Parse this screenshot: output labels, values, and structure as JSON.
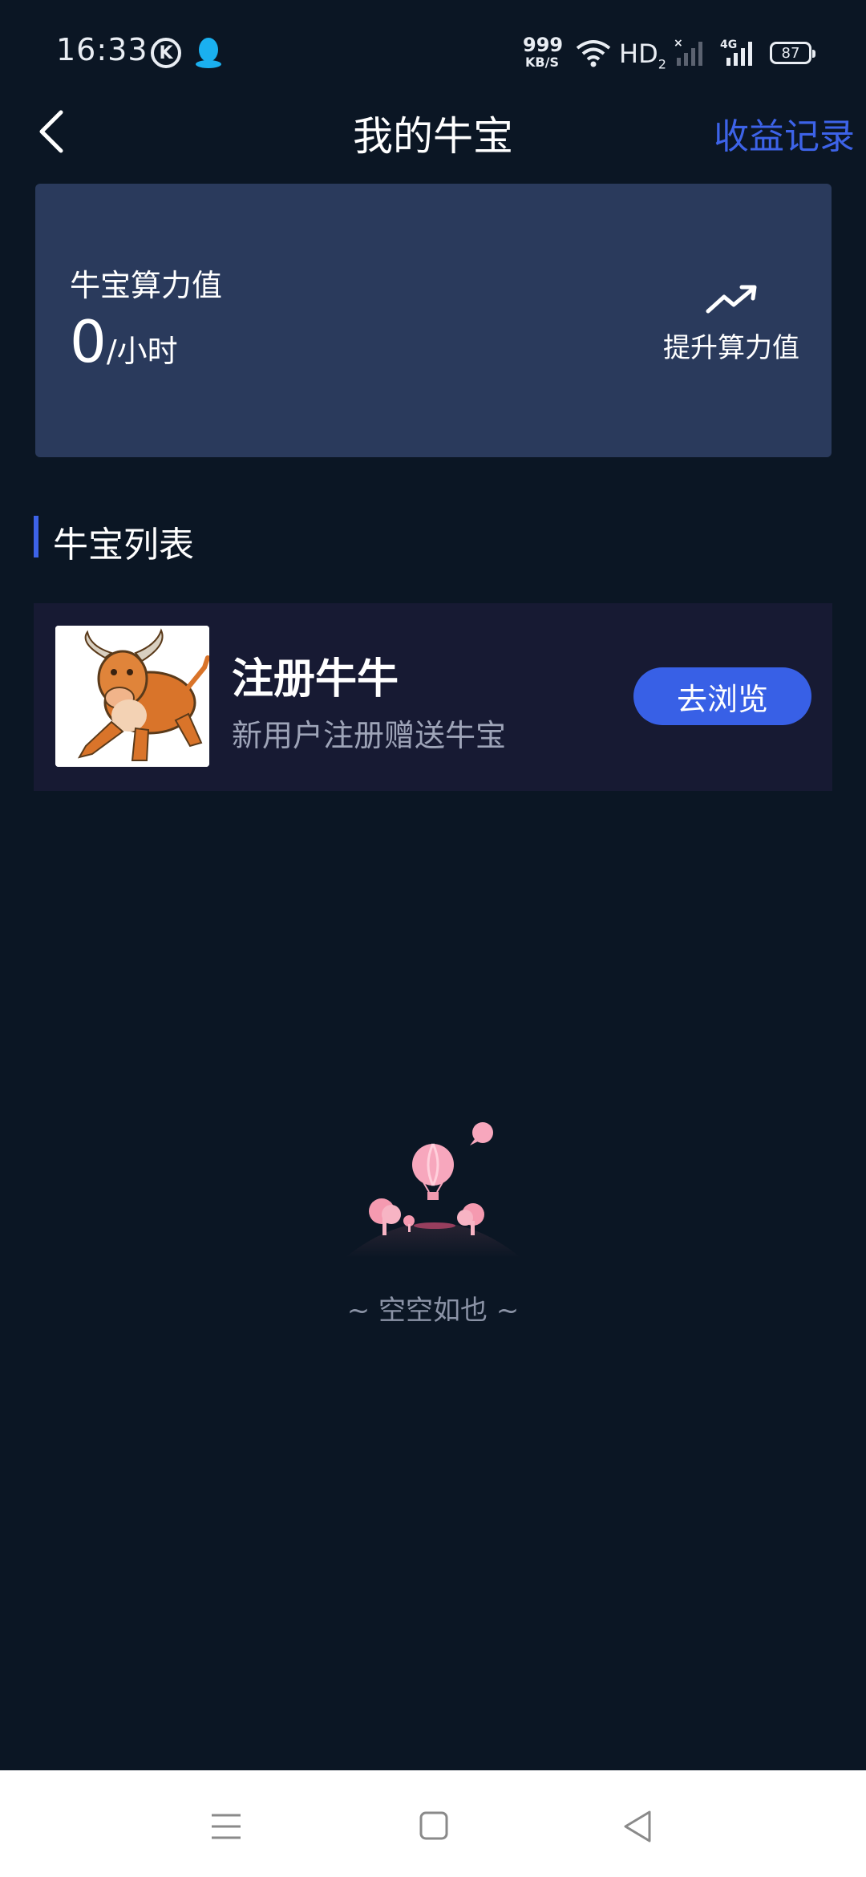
{
  "status_bar": {
    "time": "16:33",
    "net_speed_value": "999",
    "net_speed_unit": "KB/S",
    "hd_label": "HD",
    "hd_sub": "2",
    "network_type": "4G",
    "battery": "87",
    "icons": [
      "k-icon",
      "qq-icon",
      "wifi-icon",
      "signal-icon",
      "battery-icon"
    ]
  },
  "header": {
    "title": "我的牛宝",
    "earnings_link": "收益记录"
  },
  "power_card": {
    "label": "牛宝算力值",
    "value": "0",
    "unit": "/小时",
    "boost_label": "提升算力值"
  },
  "section": {
    "title": "牛宝列表"
  },
  "list": {
    "items": [
      {
        "title": "注册牛牛",
        "description": "新用户注册赠送牛宝",
        "button": "去浏览"
      }
    ]
  },
  "empty_state": {
    "text": "~ 空空如也 ~"
  },
  "colors": {
    "background": "#0b1624",
    "card": "#2a3a5c",
    "list_item": "#171a33",
    "accent": "#3d63e8",
    "button": "#3860e6"
  }
}
